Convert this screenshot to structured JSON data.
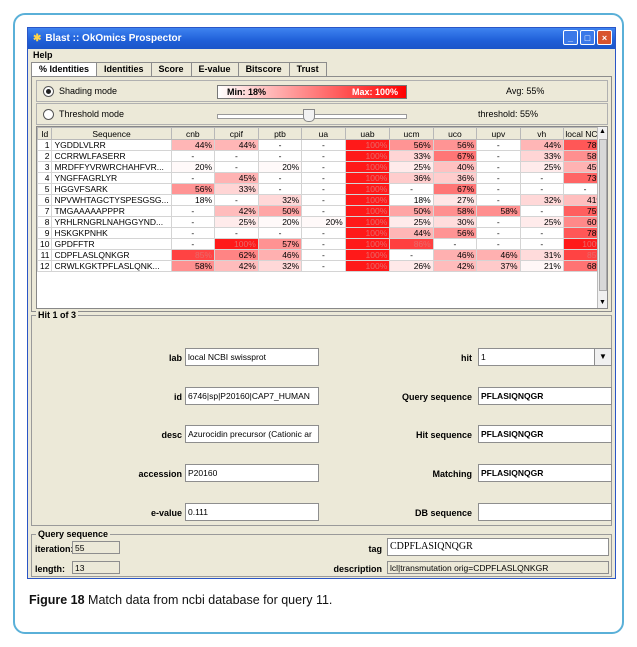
{
  "window": {
    "title": "Blast :: OkOmics Prospector",
    "controls": [
      "_",
      "□",
      "×"
    ]
  },
  "menu": {
    "help": "Help"
  },
  "tabs": [
    {
      "label": "% Identities",
      "active": true
    },
    {
      "label": "Identities",
      "active": false
    },
    {
      "label": "Score",
      "active": false
    },
    {
      "label": "E-value",
      "active": false
    },
    {
      "label": "Bitscore",
      "active": false
    },
    {
      "label": "Trust",
      "active": false
    }
  ],
  "shading": {
    "label": "Shading mode",
    "min": "Min: 18%",
    "max": "Max: 100%",
    "avg": "Avg: 55%"
  },
  "threshold": {
    "label": "Threshold mode",
    "value": "threshold: 55%",
    "slider_fraction": 0.48
  },
  "table": {
    "columns": [
      "Id",
      "Sequence",
      "cnb",
      "cpif",
      "ptb",
      "ua",
      "uab",
      "ucm",
      "uco",
      "upv",
      "vh",
      "local NC..."
    ],
    "rows": [
      {
        "id": "1",
        "seq": "YGDDLVLRR",
        "vals": [
          "44%",
          "44%",
          "-",
          "-",
          "100%",
          "56%",
          "56%",
          "-",
          "44%",
          "78%"
        ]
      },
      {
        "id": "2",
        "seq": "CCRRWLFASERR",
        "vals": [
          "-",
          "-",
          "-",
          "-",
          "100%",
          "33%",
          "67%",
          "-",
          "33%",
          "58%"
        ]
      },
      {
        "id": "3",
        "seq": "MRDFFYVRWRCHAHFVR...",
        "vals": [
          "20%",
          "-",
          "20%",
          "-",
          "100%",
          "25%",
          "40%",
          "-",
          "25%",
          "45%"
        ]
      },
      {
        "id": "4",
        "seq": "YNGFFAGRLYR",
        "vals": [
          "-",
          "45%",
          "-",
          "-",
          "100%",
          "36%",
          "36%",
          "-",
          "-",
          "73%"
        ]
      },
      {
        "id": "5",
        "seq": "HGGVFSARK",
        "vals": [
          "56%",
          "33%",
          "-",
          "-",
          "100%",
          "-",
          "67%",
          "-",
          "-",
          "-"
        ]
      },
      {
        "id": "6",
        "seq": "NPVWHTAGCTYSPESGSG...",
        "vals": [
          "18%",
          "-",
          "32%",
          "-",
          "100%",
          "18%",
          "27%",
          "-",
          "32%",
          "41%"
        ]
      },
      {
        "id": "7",
        "seq": "TMGAAAAAPPPR",
        "vals": [
          "-",
          "42%",
          "50%",
          "-",
          "100%",
          "50%",
          "58%",
          "58%",
          "-",
          "75%"
        ]
      },
      {
        "id": "8",
        "seq": "YRHLRNGRLNAHGGYND...",
        "vals": [
          "-",
          "25%",
          "20%",
          "20%",
          "100%",
          "25%",
          "30%",
          "-",
          "25%",
          "60%"
        ]
      },
      {
        "id": "9",
        "seq": "HSKGKPNHK",
        "vals": [
          "-",
          "-",
          "-",
          "-",
          "100%",
          "44%",
          "56%",
          "-",
          "-",
          "78%"
        ]
      },
      {
        "id": "10",
        "seq": "GPDFFTR",
        "vals": [
          "-",
          "100%",
          "57%",
          "-",
          "100%",
          "86%",
          "-",
          "-",
          "-",
          "100%"
        ]
      },
      {
        "id": "11",
        "seq": "CDPFLASLQNKGR",
        "vals": [
          "85%",
          "62%",
          "46%",
          "-",
          "100%",
          "-",
          "46%",
          "46%",
          "31%",
          "85%"
        ]
      },
      {
        "id": "12",
        "seq": "CRWLKGKTPFLASLQNK...",
        "vals": [
          "58%",
          "42%",
          "32%",
          "-",
          "100%",
          "26%",
          "42%",
          "37%",
          "21%",
          "68%"
        ]
      }
    ]
  },
  "hit": {
    "legend": "Hit 1 of 3",
    "lab_label": "lab",
    "lab_value": "local NCBI swissprot",
    "id_label": "id",
    "id_value": "6746|sp|P20160|CAP7_HUMAN",
    "desc_label": "desc",
    "desc_value": "Azurocidin precursor (Cationic ar",
    "accession_label": "accession",
    "accession_value": "P20160",
    "evalue_label": "e-value",
    "evalue_value": "0.111",
    "hit_label": "hit",
    "hit_value": "1",
    "query_label": "Query sequence",
    "query_value": "PFLASIQNQGR",
    "hitseq_label": "Hit sequence",
    "hitseq_value": "PFLASIQNQGR",
    "matching_label": "Matching",
    "matching_value": "PFLASIQNQGR",
    "db_label": "DB sequence",
    "db_value": ""
  },
  "query": {
    "legend": "Query sequence",
    "iteration_label": "iteration:",
    "iteration_value": "55",
    "length_label": "length:",
    "length_value": "13",
    "tag_label": "tag",
    "tag_value": "CDPFLASIQNQGR",
    "description_label": "description",
    "description_value": "lcl|transmutation orig=CDPFLASLQNKGR"
  },
  "caption": {
    "bold": "Figure 18",
    "text": " Match data from ncbi database for query 11."
  },
  "colors": {
    "title_bar": "#1f5fd8",
    "heat_max": "#ff0000",
    "figure_border": "#5ab0d8"
  }
}
